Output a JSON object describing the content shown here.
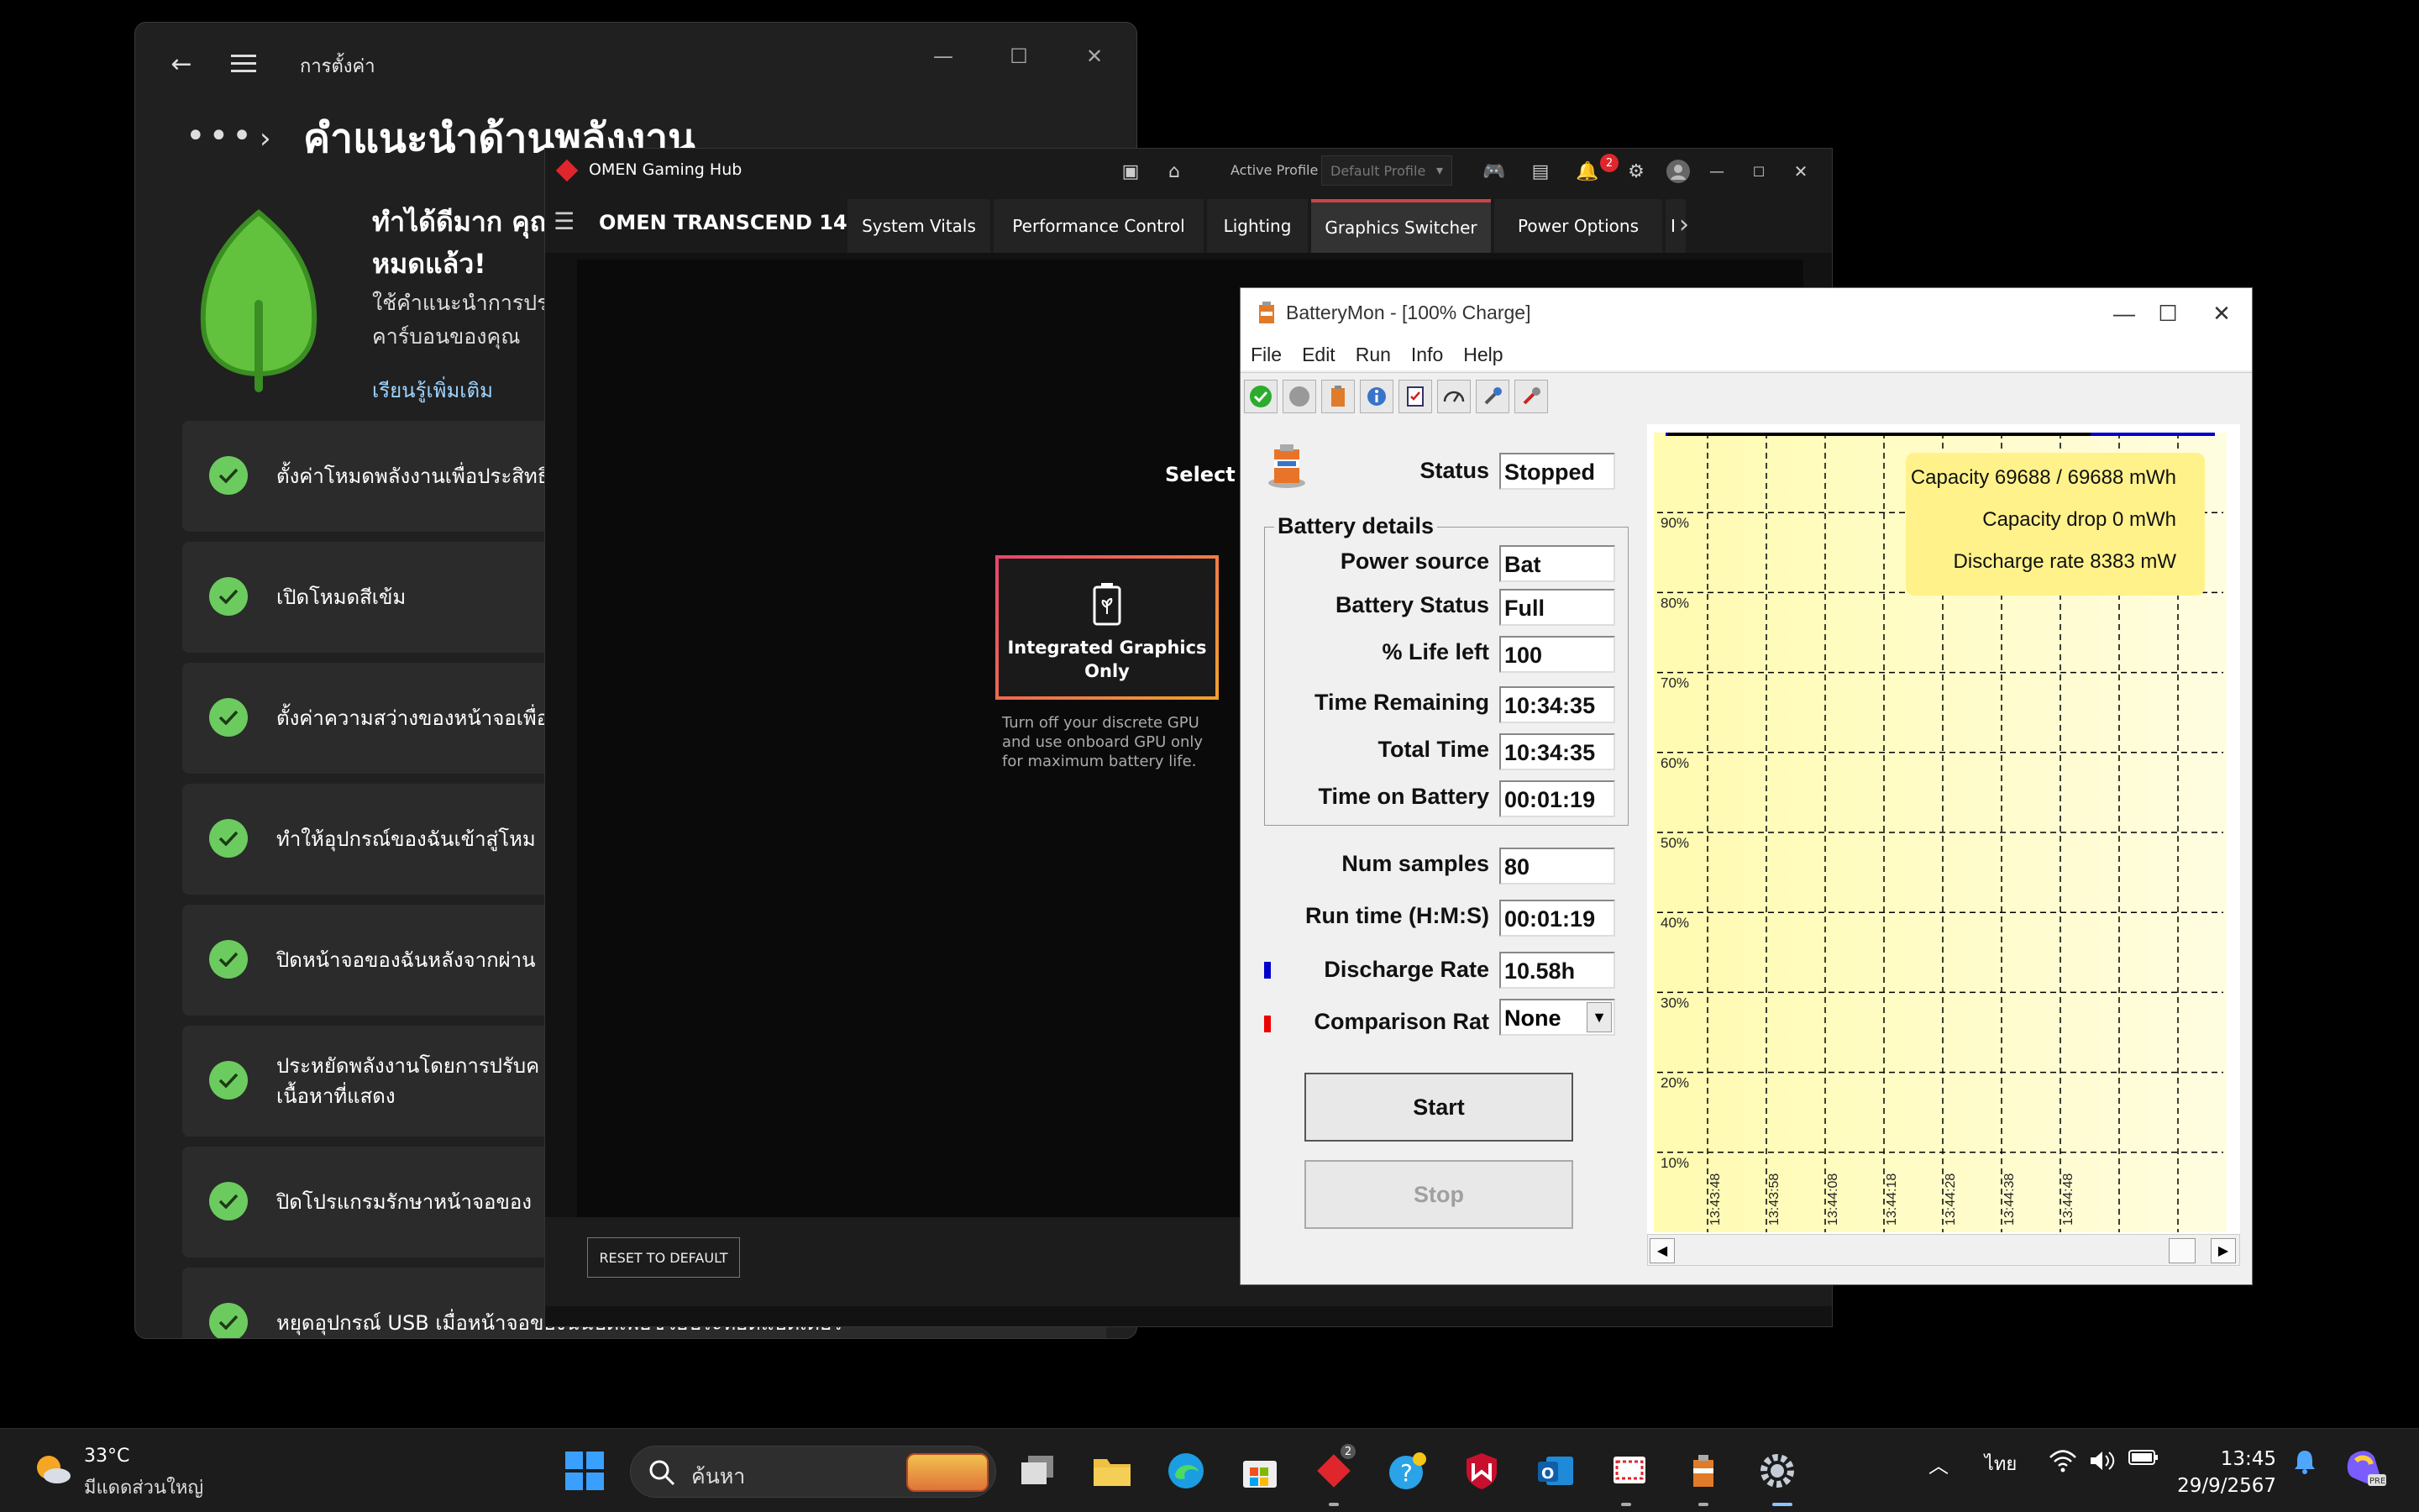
{
  "settings": {
    "app_title": "การตั้งค่า",
    "heading": "คำแนะนำด้านพลังงาน",
    "hero_title": "ทำได้ดีมาก คุณ หมดแล้ว!",
    "hero_desc_1": "ใช้คำแนะนำการประ",
    "hero_desc_2": "คาร์บอนของคุณ",
    "learn_more": "เรียนรู้เพิ่มเติม",
    "recommendations": [
      "ตั้งค่าโหมดพลังงานเพื่อประสิทธิ์",
      "เปิดโหมดสีเข้ม",
      "ตั้งค่าความสว่างของหน้าจอเพื่อ",
      "ทำให้อุปกรณ์ของฉันเข้าสู่โหม",
      "ปิดหน้าจอของฉันหลังจากผ่าน",
      "ประหยัดพลังงานโดยการปรับค เนื้อหาที่แสดง",
      "ปิดโปรแกรมรักษาหน้าจอของ",
      "หยุดอุปกรณ์ USB เมื่อหน้าจอของฉันปิดเพื่อช่วยประหยัดแบตเตอรี่"
    ]
  },
  "omen": {
    "title": "OMEN Gaming Hub",
    "active_profile_label": "Active Profile",
    "active_profile_value": "Default Profile",
    "notification_count": "2",
    "device_name": "OMEN TRANSCEND 14",
    "tabs": [
      "System Vitals",
      "Performance Control",
      "Lighting",
      "Graphics Switcher",
      "Power Options",
      "I"
    ],
    "active_tab": "Graphics Switcher",
    "select_gpu": "Select a GPU",
    "card_label": "Integrated Graphics Only",
    "card_desc": "Turn off your discrete GPU and use onboard GPU only for maximum battery life.",
    "reset": "RESET TO DEFAULT"
  },
  "batterymon": {
    "title": "BatteryMon - [100% Charge]",
    "menu": [
      "File",
      "Edit",
      "Run",
      "Info",
      "Help"
    ],
    "status_label": "Status",
    "status_value": "Stopped",
    "group_title": "Battery details",
    "details": [
      {
        "label": "Power source",
        "value": "Bat"
      },
      {
        "label": "Battery Status",
        "value": "Full"
      },
      {
        "label": "% Life left",
        "value": "100"
      },
      {
        "label": "Time Remaining",
        "value": "10:34:35"
      },
      {
        "label": "Total Time",
        "value": "10:34:35"
      },
      {
        "label": "Time on Battery",
        "value": "00:01:19"
      }
    ],
    "num_samples_label": "Num samples",
    "num_samples_value": "80",
    "run_time_label": "Run time (H:M:S)",
    "run_time_value": "00:01:19",
    "discharge_label": "Discharge Rate",
    "discharge_value": "10.58h",
    "comparison_label": "Comparison Rat",
    "comparison_value": "None",
    "start": "Start",
    "stop": "Stop",
    "legend": {
      "capacity": "Capacity 69688 / 69688 mWh",
      "capacity_drop": "Capacity drop 0 mWh",
      "discharge_rate": "Discharge rate 8383 mW"
    },
    "chart_data": {
      "type": "line",
      "y_ticks": [
        "90%",
        "80%",
        "70%",
        "60%",
        "50%",
        "40%",
        "30%",
        "20%",
        "10%"
      ],
      "x_ticks": [
        "13:43:48",
        "13:43:58",
        "13:44:08",
        "13:44:18",
        "13:44:28",
        "13:44:38",
        "13:44:48"
      ],
      "ylim": [
        0,
        100
      ],
      "grid": true,
      "background": "#fffbb0",
      "series": [
        {
          "color": "#0000cc",
          "values": [
            100,
            100,
            100,
            100,
            100,
            100,
            100
          ]
        }
      ]
    }
  },
  "taskbar": {
    "temperature": "33°C",
    "condition": "มีแดดส่วนใหญ่",
    "search_placeholder": "ค้นหา",
    "language": "ไทย",
    "time": "13:45",
    "date": "29/9/2567",
    "omen_badge": "2"
  },
  "colors": {
    "accent_green": "#6ccb5f",
    "omen_red": "#e0262d",
    "chart_yellow": "#fffbb0",
    "discharge_marker": "#0000cc",
    "comparison_marker": "#ee0000"
  }
}
